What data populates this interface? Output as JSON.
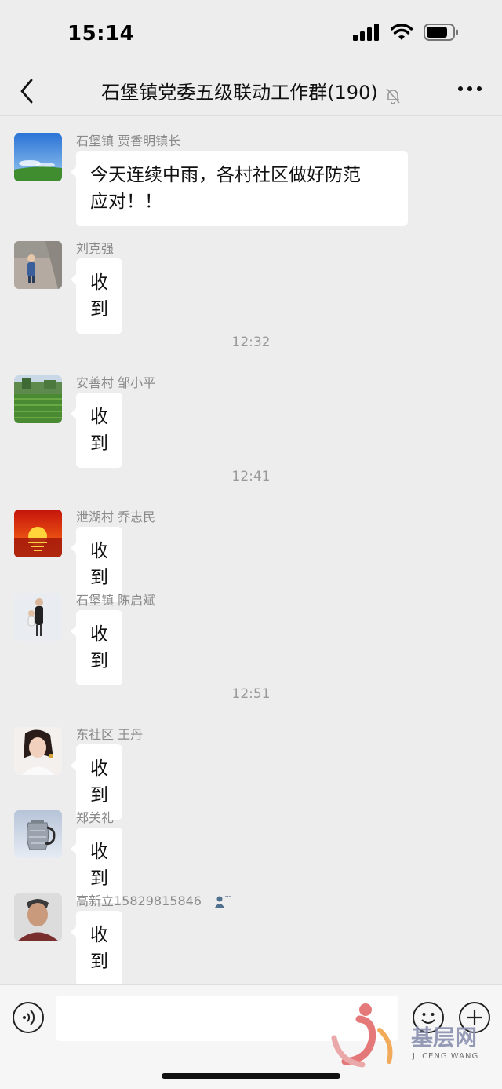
{
  "status_bar": {
    "time": "15:14"
  },
  "nav": {
    "title": "石堡镇党委五级联动工作群(190)"
  },
  "messages": [
    {
      "sender": "石堡镇 贾香明镇长",
      "text": "今天连续中雨，各村社区做好防范\n应对！！"
    },
    {
      "sender": "刘克强",
      "text": "收到"
    },
    {
      "sender": "安善村 邹小平",
      "text": "收到"
    },
    {
      "sender": "泄湖村 乔志民",
      "text": "收到"
    },
    {
      "sender": "石堡镇 陈启斌",
      "text": "收到"
    },
    {
      "sender": "东社区 王丹",
      "text": "收到"
    },
    {
      "sender": "郑关礼",
      "text": "收到"
    },
    {
      "sender": "高新立15829815846",
      "text": "收到"
    }
  ],
  "timestamps": [
    "12:32",
    "12:41",
    "12:51"
  ],
  "watermark": {
    "name": "基层网",
    "sub": "JI CENG WANG"
  },
  "icons": {
    "back": "chevron-left-icon",
    "mute": "bell-off-icon",
    "more": "more-dots-icon",
    "voice": "voice-icon",
    "emoji": "emoji-icon",
    "plus": "plus-icon"
  }
}
